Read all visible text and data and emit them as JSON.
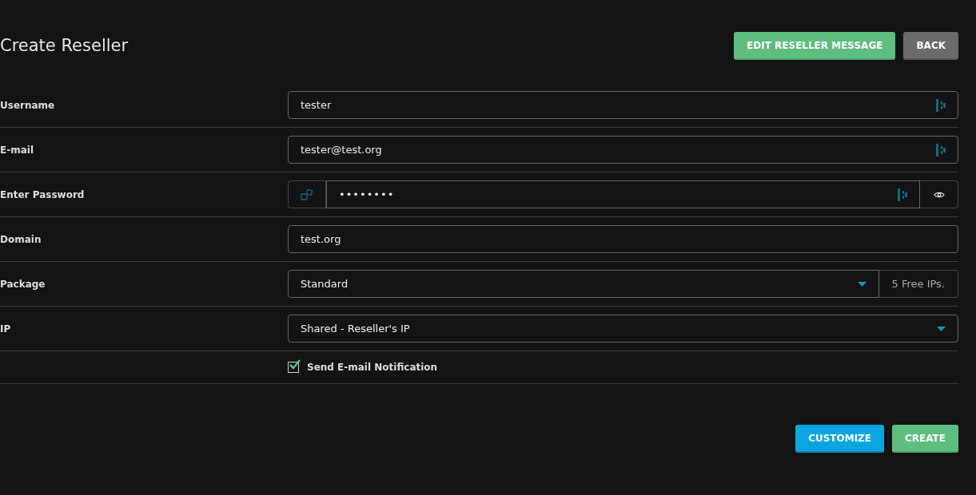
{
  "title": "Create Reseller",
  "header_buttons": [
    {
      "label": "EDIT RESELLER MESSAGE",
      "kind": "success"
    },
    {
      "label": "BACK",
      "kind": "secondary"
    }
  ],
  "fields": [
    {
      "kind": "text",
      "label": "Username",
      "value": "tester",
      "manager_icon": true
    },
    {
      "kind": "text",
      "label": "E-mail",
      "value": "tester@test.org",
      "manager_icon": true
    },
    {
      "kind": "password",
      "label": "Enter Password",
      "value": "••••••••",
      "manager_icon": true
    },
    {
      "kind": "text",
      "label": "Domain",
      "value": "test.org",
      "manager_icon": false
    },
    {
      "kind": "select",
      "label": "Package",
      "value": "Standard",
      "addon": "5 Free IPs."
    },
    {
      "kind": "select",
      "label": "IP",
      "value": "Shared - Reseller's IP"
    },
    {
      "kind": "checkbox",
      "text": "Send E-mail Notification",
      "checked": true
    }
  ],
  "footer_buttons": [
    {
      "label": "CUSTOMIZE",
      "kind": "primary"
    },
    {
      "label": "CREATE",
      "kind": "success"
    }
  ]
}
